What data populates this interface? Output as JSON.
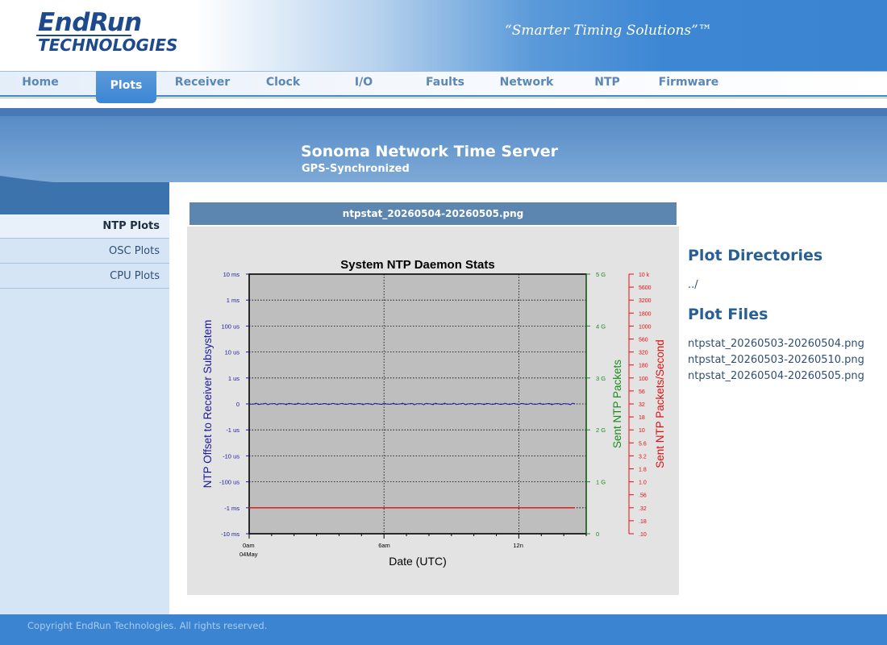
{
  "header": {
    "logo_line1": "EndRun",
    "logo_line2": "TECHNOLOGIES",
    "tagline": "“Smarter Timing Solutions”™"
  },
  "nav": {
    "items": [
      {
        "label": "Home",
        "active": false
      },
      {
        "label": "Plots",
        "active": true
      },
      {
        "label": "Receiver",
        "active": false
      },
      {
        "label": "Clock",
        "active": false
      },
      {
        "label": "I/O",
        "active": false
      },
      {
        "label": "Faults",
        "active": false
      },
      {
        "label": "Network",
        "active": false
      },
      {
        "label": "NTP",
        "active": false
      },
      {
        "label": "Firmware",
        "active": false
      }
    ]
  },
  "banner": {
    "title": "Sonoma Network Time Server",
    "subtitle": "GPS-Synchronized"
  },
  "sidebar": {
    "items": [
      {
        "label": "NTP Plots",
        "active": true
      },
      {
        "label": "OSC Plots",
        "active": false
      },
      {
        "label": "CPU Plots",
        "active": false
      }
    ]
  },
  "plot": {
    "filename": "ntpstat_20260504-20260505.png"
  },
  "right": {
    "dirs_heading": "Plot Directories",
    "dirs": [
      "../"
    ],
    "files_heading": "Plot Files",
    "files": [
      "ntpstat_20260503-20260504.png",
      "ntpstat_20260503-20260510.png",
      "ntpstat_20260504-20260505.png"
    ]
  },
  "footer": {
    "copyright": "Copyright EndRun Technologies. All rights reserved."
  },
  "colors": {
    "brand_blue": "#3a84d2",
    "offset_series": "#1a1aa0",
    "packets_series": "#1a8a1a",
    "rate_series": "#e01010"
  },
  "chart_data": {
    "type": "line",
    "title": "System NTP Daemon Stats",
    "xlabel": "Date (UTC)",
    "x_ticks": [
      "0am",
      "6am",
      "12n"
    ],
    "x_tick_sub": "04May",
    "x_range_hours": [
      0,
      15
    ],
    "left_axis": {
      "label": "NTP Offset to Receiver Subsystem",
      "ticks": [
        "10 ms",
        "1 ms",
        "100 us",
        "10 us",
        "1 us",
        "0",
        "-1 us",
        "-10 us",
        "-100 us",
        "-1 ms",
        "-10 ms"
      ],
      "color": "#1a1aa0"
    },
    "right_axis_1": {
      "label": "Sent NTP Packets",
      "ticks": [
        "5 G",
        "4 G",
        "3 G",
        "2 G",
        "1 G",
        "0"
      ],
      "color": "#1a8a1a"
    },
    "right_axis_2": {
      "label": "Sent NTP Packets/Second",
      "ticks": [
        "10 k",
        "5600",
        "3200",
        "1800",
        "1000",
        "560",
        "320",
        "180",
        "100",
        "56",
        "32",
        "18",
        "10",
        "5.6",
        "3.2",
        "1.8",
        "1.0",
        ".56",
        ".32",
        ".18",
        ".10"
      ],
      "color": "#e01010"
    },
    "grid": true,
    "series": [
      {
        "name": "NTP Offset",
        "axis": "left",
        "x_hours": [
          0,
          14.5
        ],
        "values": [
          0,
          0
        ]
      },
      {
        "name": "Sent NTP Packets/Second",
        "axis": "right_2",
        "x_hours": [
          0,
          14.5
        ],
        "values": [
          0.32,
          0.32
        ]
      }
    ]
  }
}
